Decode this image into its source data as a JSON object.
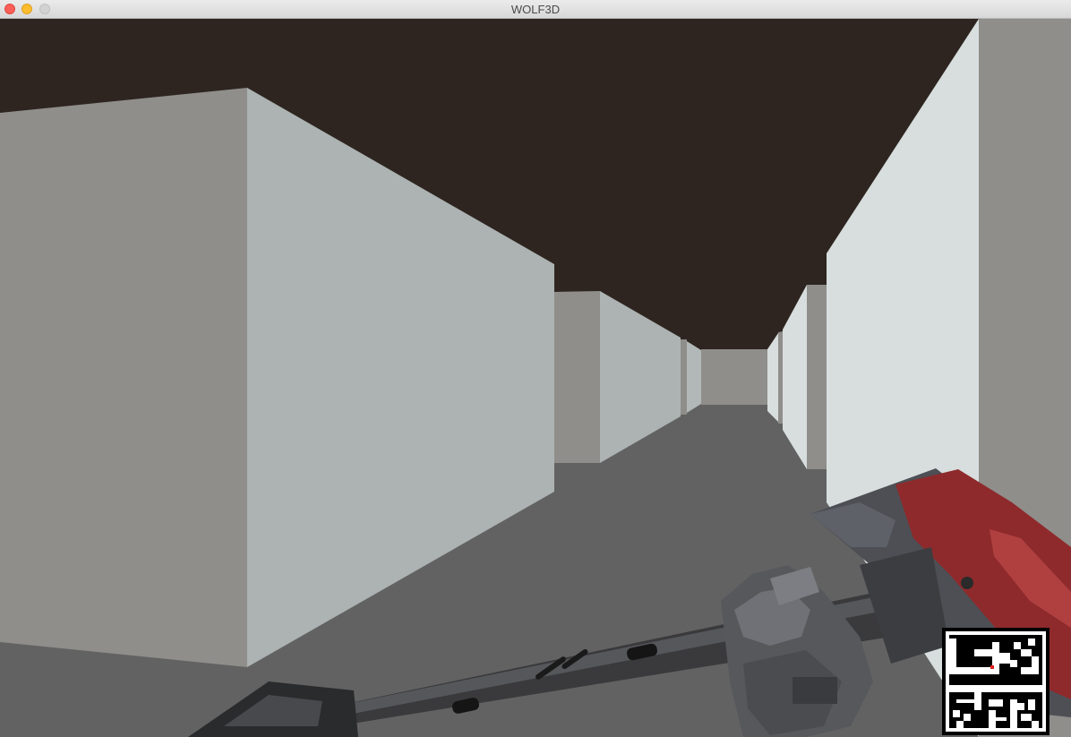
{
  "window": {
    "title": "WOLF3D"
  },
  "scene": {
    "ceiling_color": "#2e2520",
    "floor_color": "#626262",
    "wall_light_color": "#acb3b2",
    "wall_far_light_color": "#d7dedd",
    "wall_gray_color": "#8f8e8b",
    "weapon": "fire-axe"
  },
  "minimap": {
    "player_color": "#e02020",
    "wall_color": "#ffffff"
  }
}
